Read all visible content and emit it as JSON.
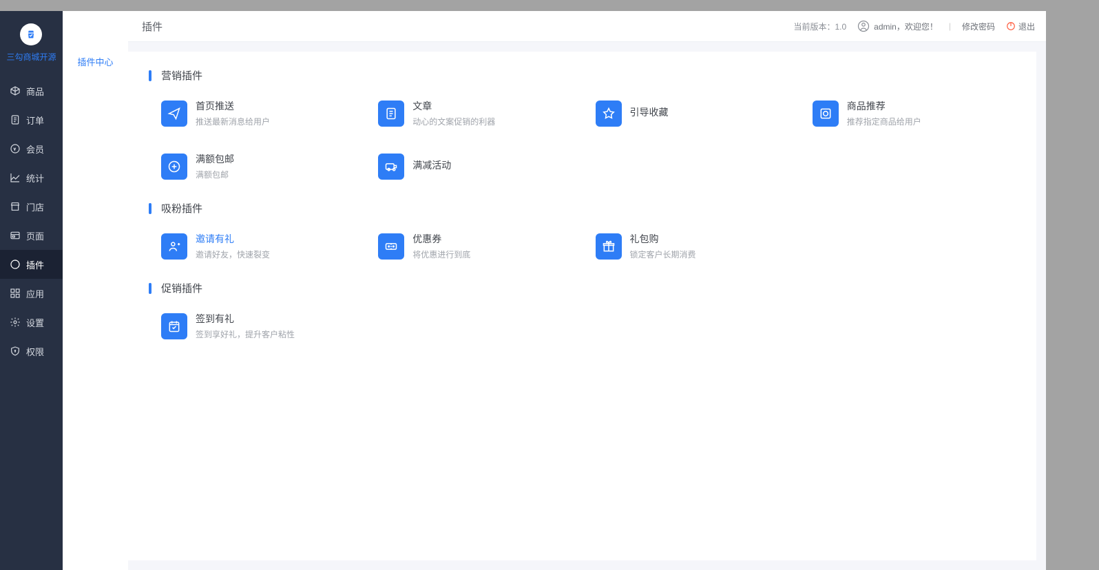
{
  "brand": {
    "name": "三勾商城开源"
  },
  "sidebar": {
    "items": [
      {
        "label": "商品",
        "key": "product"
      },
      {
        "label": "订单",
        "key": "order"
      },
      {
        "label": "会员",
        "key": "member"
      },
      {
        "label": "统计",
        "key": "stats"
      },
      {
        "label": "门店",
        "key": "store"
      },
      {
        "label": "页面",
        "key": "page"
      },
      {
        "label": "插件",
        "key": "plugin",
        "active": true
      },
      {
        "label": "应用",
        "key": "app"
      },
      {
        "label": "设置",
        "key": "settings"
      },
      {
        "label": "权限",
        "key": "permission"
      }
    ]
  },
  "secondary": {
    "items": [
      {
        "label": "插件中心"
      }
    ]
  },
  "header": {
    "title": "插件",
    "version_label": "当前版本：",
    "version": "1.0",
    "user": "admin",
    "welcome": "，欢迎您！",
    "change_pwd": "修改密码",
    "logout": "退出"
  },
  "sections": [
    {
      "title": "营销插件",
      "plugins": [
        {
          "title": "首页推送",
          "desc": "推送最新消息给用户",
          "icon": "send"
        },
        {
          "title": "文章",
          "desc": "动心的文案促销的利器",
          "icon": "doc"
        },
        {
          "title": "引导收藏",
          "desc": "",
          "icon": "star"
        },
        {
          "title": "商品推荐",
          "desc": "推荐指定商品给用户",
          "icon": "recommend"
        },
        {
          "title": "满额包邮",
          "desc": "满额包邮",
          "icon": "shipping"
        },
        {
          "title": "满减活动",
          "desc": "",
          "icon": "discount"
        }
      ]
    },
    {
      "title": "吸粉插件",
      "plugins": [
        {
          "title": "邀请有礼",
          "desc": "邀请好友，快速裂变",
          "icon": "invite",
          "highlight": true
        },
        {
          "title": "优惠券",
          "desc": "将优惠进行到底",
          "icon": "coupon"
        },
        {
          "title": "礼包购",
          "desc": "锁定客户长期消费",
          "icon": "gift"
        }
      ]
    },
    {
      "title": "促销插件",
      "plugins": [
        {
          "title": "签到有礼",
          "desc": "签到享好礼，提升客户粘性",
          "icon": "checkin"
        }
      ]
    }
  ]
}
